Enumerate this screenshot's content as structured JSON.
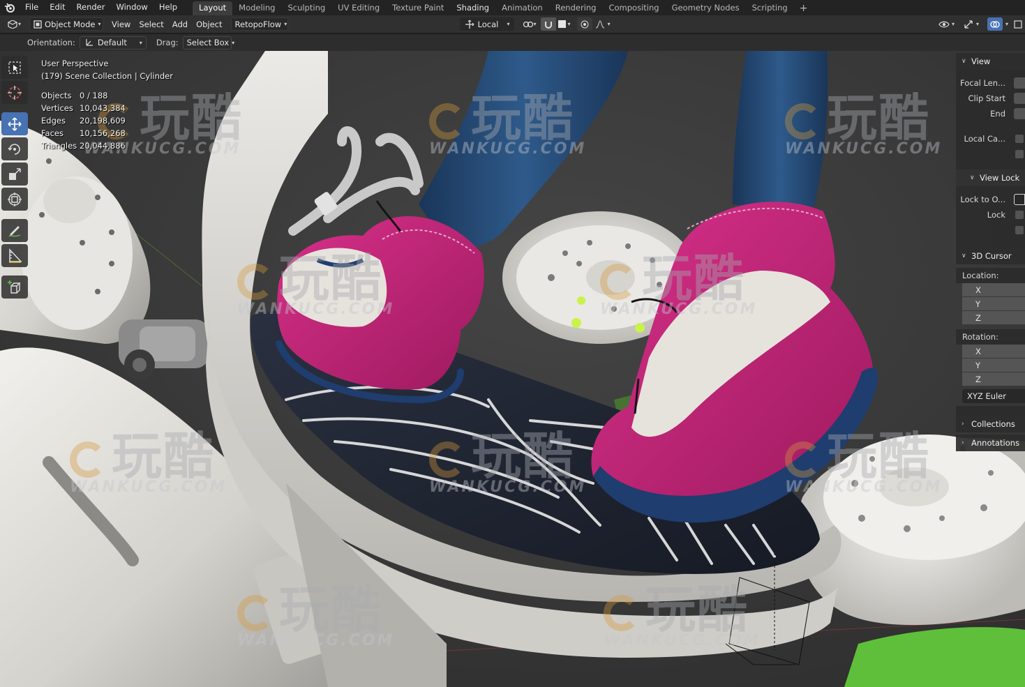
{
  "menu": {
    "items": [
      "File",
      "Edit",
      "Render",
      "Window",
      "Help"
    ]
  },
  "workspaces": {
    "tabs": [
      "Layout",
      "Modeling",
      "Sculpting",
      "UV Editing",
      "Texture Paint",
      "Shading",
      "Animation",
      "Rendering",
      "Compositing",
      "Geometry Nodes",
      "Scripting"
    ],
    "active": "Layout",
    "add_label": "+"
  },
  "header": {
    "mode": "Object Mode",
    "menus": [
      "View",
      "Select",
      "Add",
      "Object"
    ],
    "addon": "RetopoFlow",
    "transform_space": "Local"
  },
  "toolsettings": {
    "orientation_label": "Orientation:",
    "orientation_value": "Default",
    "drag_label": "Drag:",
    "drag_value": "Select Box"
  },
  "overlay": {
    "perspective": "User Perspective",
    "collection": "(179) Scene Collection | Cylinder",
    "stats": [
      {
        "key": "Objects",
        "value": "0 / 188"
      },
      {
        "key": "Vertices",
        "value": "10,043,384"
      },
      {
        "key": "Edges",
        "value": "20,198,609"
      },
      {
        "key": "Faces",
        "value": "10,156,268"
      },
      {
        "key": "Triangles",
        "value": "20,044,886"
      }
    ]
  },
  "npanel": {
    "view_header": "View",
    "focal_length": "Focal Len...",
    "clip_start": "Clip Start",
    "clip_end": "End",
    "local_camera": "Local Ca...",
    "view_lock_header": "View Lock",
    "lock_to_object": "Lock to O...",
    "lock": "Lock",
    "cursor_header": "3D Cursor",
    "location_label": "Location:",
    "rotation_label": "Rotation:",
    "axes": [
      "X",
      "Y",
      "Z"
    ],
    "rotation_mode": "XYZ Euler",
    "collections_header": "Collections",
    "annotations_header": "Annotations"
  },
  "watermark": {
    "cn": "玩酷",
    "en": "WANKUCG.COM"
  },
  "colors": {
    "accent": "#4772b3",
    "shoe_pink": "#c2287a",
    "sole_navy": "#1f3d6e",
    "platform_white": "#d9d7d2",
    "led_green": "#c9f24a"
  }
}
